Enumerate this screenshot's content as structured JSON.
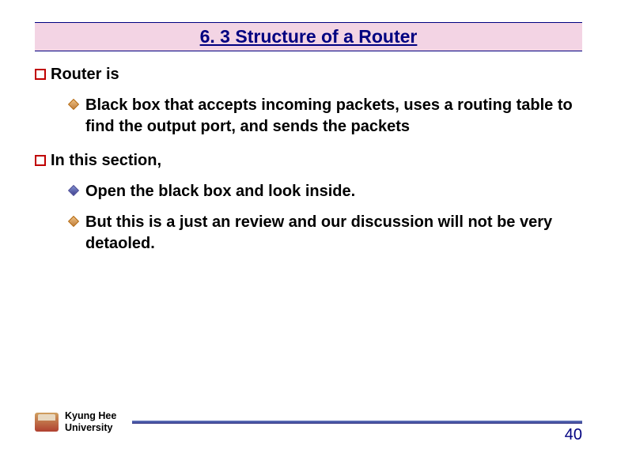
{
  "title": "6. 3 Structure of a Router",
  "sections": [
    {
      "heading": "Router is",
      "items": [
        {
          "bullet": "orange",
          "text": "Black box that accepts incoming packets, uses a routing table to find the output  port, and sends the packets"
        }
      ]
    },
    {
      "heading": "In this section,",
      "items": [
        {
          "bullet": "blue",
          "text": "Open the black box and look inside."
        },
        {
          "bullet": "orange",
          "text": "But this is a just an review and our discussion will not be very detaoled."
        }
      ]
    }
  ],
  "footer": {
    "university_line1": "Kyung Hee",
    "university_line2": "University",
    "page": "40"
  }
}
